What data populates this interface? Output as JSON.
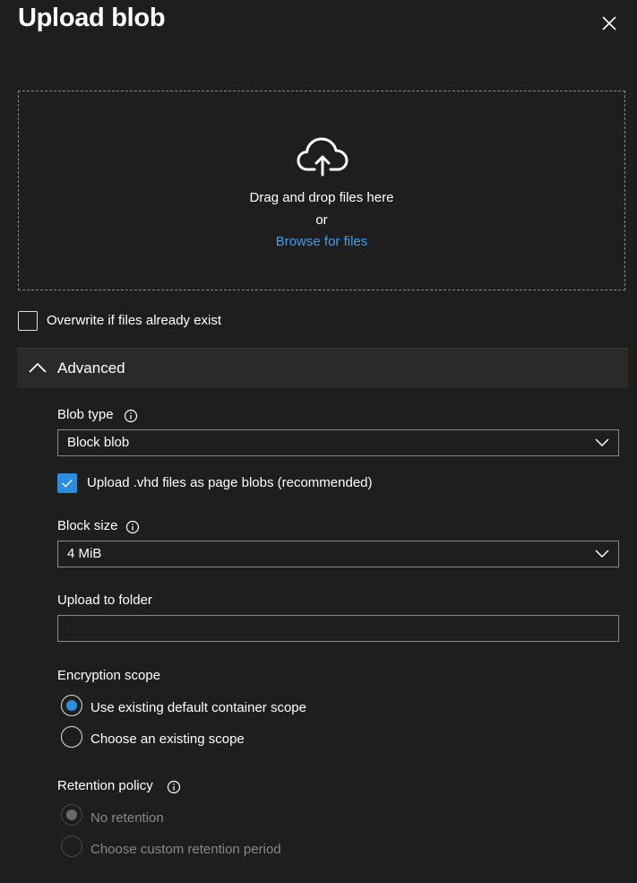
{
  "panel": {
    "title": "Upload blob",
    "close_icon": "close-icon"
  },
  "dropzone": {
    "icon": "cloud-upload-icon",
    "drag_text": "Drag and drop files here",
    "or_text": "or",
    "browse_link": "Browse for files"
  },
  "overwrite": {
    "label": "Overwrite if files already exist",
    "checked": false
  },
  "advanced": {
    "label": "Advanced",
    "expanded": true,
    "icon": "chevron-up-icon"
  },
  "blob_type": {
    "label": "Blob type",
    "info_icon": "info-icon",
    "value": "Block blob"
  },
  "vhd_option": {
    "label": "Upload .vhd files as page blobs (recommended)",
    "checked": true
  },
  "block_size": {
    "label": "Block size",
    "info_icon": "info-icon",
    "value": "4 MiB"
  },
  "upload_folder": {
    "label": "Upload to folder",
    "value": ""
  },
  "encryption_scope": {
    "label": "Encryption scope",
    "options": [
      {
        "label": "Use existing default container scope",
        "selected": true
      },
      {
        "label": "Choose an existing scope",
        "selected": false
      }
    ]
  },
  "retention_policy": {
    "label": "Retention policy",
    "info_icon": "info-icon",
    "options": [
      {
        "label": "No retention",
        "selected": true,
        "disabled": true
      },
      {
        "label": "Choose custom retention period",
        "selected": false,
        "disabled": true
      }
    ]
  },
  "colors": {
    "background": "#1f1e1e",
    "accent": "#2a8ee0",
    "link": "#3aa0f3",
    "border": "#8a8886",
    "section_header": "#2b2a29"
  }
}
